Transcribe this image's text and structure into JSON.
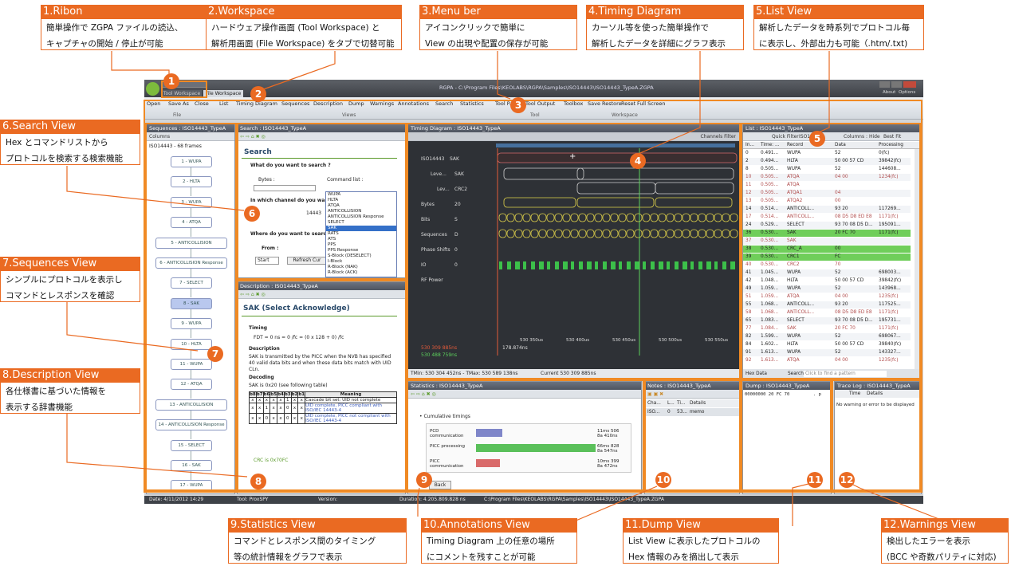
{
  "callouts": [
    {
      "num": "1",
      "title": "1.Ribon",
      "lines": [
        "簡単操作で ZGPA ファイルの読込、",
        "キャプチャの開始 / 停止が可能"
      ]
    },
    {
      "num": "2",
      "title": "2.Workspace",
      "lines": [
        "ハードウェア操作画面 (Tool Workspace) と",
        "解析用画面 (File Workspace) をタブで切替可能"
      ]
    },
    {
      "num": "3",
      "title": "3.Menu ber",
      "lines": [
        "アイコンクリックで簡単に",
        "View の出現や配置の保存が可能"
      ]
    },
    {
      "num": "4",
      "title": "4.Timing Diagram",
      "lines": [
        "カーソル等を使った簡単操作で",
        "解析したデータを詳細にグラフ表示"
      ]
    },
    {
      "num": "5",
      "title": "5.List View",
      "lines": [
        "解析したデータを時系列でプロトコル毎",
        "に表示し、外部出力も可能（.htm/.txt)"
      ]
    },
    {
      "num": "6",
      "title": "6.Search View",
      "lines": [
        "Hex とコマンドリストから",
        "プロトコルを検索する検索機能"
      ]
    },
    {
      "num": "7",
      "title": "7.Sequences View",
      "lines": [
        "シンプルにプロトコルを表示し",
        "コマンドとレスポンスを確認"
      ]
    },
    {
      "num": "8",
      "title": "8.Description View",
      "lines": [
        "各仕様書に基づいた情報を",
        "表示する辞書機能"
      ]
    },
    {
      "num": "9",
      "title": "9.Statistics View",
      "lines": [
        "コマンドとレスポンス間のタイミング",
        "等の統計情報をグラフで表示"
      ]
    },
    {
      "num": "10",
      "title": "10.Annotations View",
      "lines": [
        "Timing Diagram 上の任意の場所",
        "にコメントを残すことが可能"
      ]
    },
    {
      "num": "11",
      "title": "11.Dump View",
      "lines": [
        "List View に表示したプロトコルの",
        "Hex 情報のみを摘出して表示"
      ]
    },
    {
      "num": "12",
      "title": "12.Warnings View",
      "lines": [
        "検出したエラーを表示",
        "(BCC や奇数パリティに対応)"
      ]
    }
  ],
  "window": {
    "title": "RGPA - C:\\Program Files\\KEOLABS\\RGPA\\Samples\\ISO14443\\ISO14443_TypeA.ZGPA",
    "tabs": [
      "Tool Workspace",
      "File Workspace"
    ],
    "about": "About",
    "options": "Options",
    "ribbon": [
      "Open",
      "Save As",
      "Close",
      "List",
      "Timing Diagram",
      "Sequences",
      "Description",
      "Dump",
      "Warnings",
      "Annotations",
      "Search",
      "Statistics",
      "Tool P...",
      "Tool Output",
      "Toolbox",
      "Save",
      "Restore",
      "Reset",
      "Full Screen"
    ],
    "groups": [
      "File",
      "Views",
      "Tool",
      "Workspace"
    ]
  },
  "sequences": {
    "title": "Sequences : ISO14443_TypeA",
    "columns": "Columns",
    "header": "ISO14443 - 68 frames",
    "items": [
      "1 - WUPA",
      "2 - HLTA",
      "3 - WUPA",
      "4 - ATQA",
      "5 - ANTICOLLISION",
      "6 - ANTICOLLISION Response",
      "7 - SELECT",
      "8 - SAK",
      "9 - WUPA",
      "10 - HLTA",
      "11 - WUPA",
      "12 - ATQA",
      "13 - ANTICOLLISION",
      "14 - ANTICOLLISION Response",
      "15 - SELECT",
      "16 - SAK",
      "17 - WUPA"
    ]
  },
  "search": {
    "title": "Search : ISO14443_TypeA",
    "heading": "Search",
    "q1": "What do you want to search ?",
    "bytes": "Bytes :",
    "cmdlist": "Command list :",
    "q2": "In which channel do you want",
    "ch": "14443",
    "q3": "Where do you want to search",
    "from": "From :",
    "start": "Start",
    "refresh": "Refresh Cur",
    "list": [
      "WUPA",
      "HLTA",
      "ATQA",
      "ANTICOLLISION",
      "ANTICOLLISION Response",
      "SELECT",
      "SAK",
      "RATS",
      "ATS",
      "PPS",
      "PPS Response",
      "S-Block (DESELECT)",
      "I-Block",
      "R-Block (NAK)",
      "R-Block (ACK)"
    ]
  },
  "description": {
    "title": "Description : ISO14443_TypeA",
    "heading": "SAK (Select Acknowledge)",
    "timing": "Timing",
    "fdt": "FDT = 0 ns = 0 /fc = (0 x 128 + 0) /fc",
    "descH": "Description",
    "desc": "SAK is transmitted by the PICC when the NVB has specified 40 valid data bits and when these data bits match with UID CLn.",
    "decH": "Decoding",
    "dec": "SAK is 0x20 (see following table)",
    "thead": [
      "b8",
      "b7",
      "b6",
      "b5",
      "b4",
      "b3",
      "b2",
      "b1",
      "Meaning"
    ],
    "rows": [
      [
        "x",
        "x",
        "x",
        "x",
        "x",
        "1",
        "x",
        "x",
        "Cascade bit set: UID not complete"
      ],
      [
        "x",
        "x",
        "1",
        "x",
        "x",
        "0",
        "x",
        "x",
        "UID complete, PICC compliant with ISO/IEC 14443-4"
      ],
      [
        "x",
        "x",
        "0",
        "x",
        "x",
        "0",
        "x",
        "x",
        "UID complete, PICC not compliant with ISO/IEC 14443-4"
      ]
    ],
    "crc": "CRC is 0x70FC"
  },
  "timing": {
    "title": "Timing Diagram : ISO14443_TypeA",
    "filter": "Channels Filter",
    "channels": [
      {
        "n": "ISO14443",
        "v": "SAK"
      },
      {
        "n": "Leve...",
        "v": "SAK"
      },
      {
        "n": "Lev...",
        "v": "CRC2"
      },
      {
        "n": "Bytes",
        "v": "20"
      },
      {
        "n": "Bits",
        "v": "S"
      },
      {
        "n": "Sequences",
        "v": "D"
      },
      {
        "n": "Phase Shifts",
        "v": "0"
      },
      {
        "n": "IO",
        "v": "0"
      },
      {
        "n": "RF Power",
        "v": ""
      }
    ],
    "times": [
      "530 350us",
      "530 400us",
      "530 450us",
      "530 500us",
      "530 550us"
    ],
    "c1": "530 309 885ns",
    "c2": "530 488 759ns",
    "delta": "178.874ns",
    "tmin": "TMin: 530 304 452ns - TMax: 530 589 138ns",
    "current": "Current 530 309 885ns"
  },
  "list": {
    "title": "List : ISO14443_TypeA",
    "quick": "Quick Filter",
    "proto": "ISO14443",
    "cols": "Columns : Hide",
    "best": "Best Fit",
    "head": [
      "In...",
      "Time: ...",
      "Record",
      "Data",
      "Processing"
    ],
    "rows": [
      [
        "0",
        "0.491...",
        "WUPA",
        "52",
        "0(fc)",
        "n"
      ],
      [
        "2",
        "0.494...",
        "HLTA",
        "50 00 57 CD",
        "39842(fc)",
        "n"
      ],
      [
        "8",
        "0.505...",
        "WUPA",
        "52",
        "144608...",
        "n"
      ],
      [
        "10",
        "0.505...",
        "ATQA",
        "04 00",
        "1234(fc)",
        "r"
      ],
      [
        "11",
        "0.505...",
        "ATQA",
        "",
        "",
        "r"
      ],
      [
        "12",
        "0.505...",
        "ATQA1",
        "04",
        "",
        "r"
      ],
      [
        "13",
        "0.505...",
        "ATQA2",
        "00",
        "",
        "r"
      ],
      [
        "14",
        "0.514...",
        "ANTICOLL...",
        "93 20",
        "117269...",
        "n"
      ],
      [
        "17",
        "0.514...",
        "ANTICOLL...",
        "08 D5 D8 ED E8",
        "1171(fc)",
        "r"
      ],
      [
        "24",
        "0.529...",
        "SELECT",
        "93 70 08 D5 D...",
        "195091...",
        "n"
      ],
      [
        "36",
        "0.530...",
        "SAK",
        "20 FC 70",
        "1171(fc)",
        "g"
      ],
      [
        "37",
        "0.530...",
        "SAK",
        "",
        "",
        "r"
      ],
      [
        "38",
        "0.530...",
        "CRC_A",
        "00",
        "",
        "g"
      ],
      [
        "39",
        "0.530...",
        "CRC1",
        "FC",
        "",
        "g"
      ],
      [
        "40",
        "0.530...",
        "CRC2",
        "70",
        "",
        "r"
      ],
      [
        "41",
        "1.045...",
        "WUPA",
        "52",
        "698003...",
        "n"
      ],
      [
        "42",
        "1.048...",
        "HLTA",
        "50 00 57 CD",
        "39842(fc)",
        "n"
      ],
      [
        "49",
        "1.059...",
        "WUPA",
        "52",
        "143968...",
        "n"
      ],
      [
        "51",
        "1.059...",
        "ATQA",
        "04 00",
        "1235(fc)",
        "r"
      ],
      [
        "55",
        "1.068...",
        "ANTICOLL...",
        "93 20",
        "117525...",
        "n"
      ],
      [
        "58",
        "1.068...",
        "ANTICOLL...",
        "08 D5 D8 ED E8",
        "1171(fc)",
        "r"
      ],
      [
        "65",
        "1.083...",
        "SELECT",
        "93 70 08 D5 D...",
        "195731...",
        "n"
      ],
      [
        "77",
        "1.084...",
        "SAK",
        "20 FC 70",
        "1171(fc)",
        "r"
      ],
      [
        "82",
        "1.599...",
        "WUPA",
        "52",
        "698067...",
        "n"
      ],
      [
        "84",
        "1.602...",
        "HLTA",
        "50 00 57 CD",
        "39840(fc)",
        "n"
      ],
      [
        "91",
        "1.613...",
        "WUPA",
        "52",
        "143327...",
        "n"
      ],
      [
        "92",
        "1.613...",
        "ATQA",
        "04 00",
        "1235(fc)",
        "r"
      ]
    ],
    "hex": "Hex Data",
    "searchBtn": "Search",
    "find": "Click to find a pattern"
  },
  "statistics": {
    "title": "Statistics : ISO14443_TypeA",
    "bullet": "Cumulative timings",
    "bars": [
      {
        "label": "PCD communication",
        "value": "11ms 506",
        "sub": "8a 410ns",
        "pct": 0.22,
        "color": "#7f86c9"
      },
      {
        "label": "PICC processing",
        "value": "66ms 828",
        "sub": "8a 547ns",
        "pct": 1.0,
        "color": "#5ac05a"
      },
      {
        "label": "PICC communication",
        "value": "10ms 399",
        "sub": "8a 472ns",
        "pct": 0.2,
        "color": "#d96a6a"
      }
    ],
    "back": "Back"
  },
  "notes": {
    "title": "Notes : ISO14443_TypeA",
    "head": [
      "Cha...",
      "L...",
      "Ti...",
      "Details"
    ],
    "row": [
      "ISO...",
      "0",
      "53...",
      "memo"
    ]
  },
  "dump": {
    "title": "Dump : ISO14443_TypeA",
    "line": "00000000  20 FC 70",
    "ascii": ". p"
  },
  "trace": {
    "title": "Trace Log : ISO14443_TypeA",
    "head": [
      "Time",
      "Details"
    ],
    "msg": "No warning or error to be displayed"
  },
  "status": {
    "date": "Date: 4/11/2012 14:29",
    "tool": "Tool: ProxSPY",
    "version": "Version:",
    "duration": "Duration: 4.205.809.828 ns",
    "path": "C:\\Program Files\\KEOLABS\\RGPA\\Samples\\ISO14443\\ISO14443_TypeA.ZGPA"
  }
}
